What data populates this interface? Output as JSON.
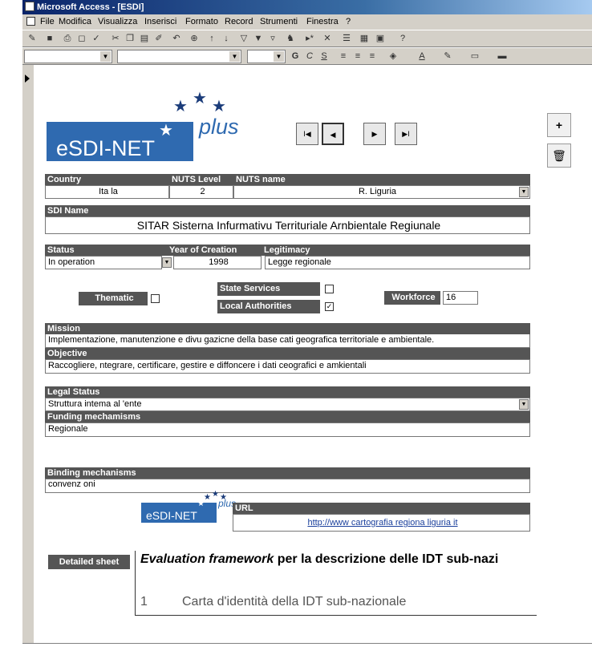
{
  "window": {
    "title": "Microsoft Access - [ESDI]"
  },
  "menu": [
    "File",
    "Modifica",
    "Visualizza",
    "Inserisci",
    "Formato",
    "Record",
    "Strumenti",
    "Finestra",
    "?"
  ],
  "toolbar2": {
    "bold": "G",
    "italic": "C",
    "underline": "S",
    "underline_A": "A"
  },
  "logo": {
    "main": "eSDI-NET",
    "suffix": "plus"
  },
  "nav": {
    "first": "I◀",
    "prev": "◀",
    "next": "▶",
    "last": "▶I"
  },
  "side_buttons": {
    "new_record": "+",
    "delete_record": "🗑"
  },
  "labels": {
    "country": "Country",
    "nuts_level": "NUTS Level",
    "nuts_name": "NUTS name",
    "sdi_name": "SDI Name",
    "status": "Status",
    "year_of_creation": "Year of Creation",
    "legitimacy": "Legitimacy",
    "thematic": "Thematic",
    "state_services": "State Services",
    "local_authorities": "Local Authorities",
    "workforce": "Workforce",
    "mission": "Mission",
    "objective": "Objective",
    "legal_status": "Legal Status",
    "funding_mechanisms": "Funding mechamisms",
    "binding_mechanisms": "Binding mechanisms",
    "url": "URL",
    "detailed_sheet": "Detailed sheet"
  },
  "values": {
    "country": "Ita la",
    "nuts_level": "2",
    "nuts_name": "R. Liguria",
    "sdi_name": "SITAR Sisterna Infurmativu Territuriale Arnbientale Regiunale",
    "status": "In operation",
    "year_of_creation": "1998",
    "legitimacy": "Legge regionale",
    "thematic_checked": false,
    "state_services_checked": false,
    "local_authorities_checked": true,
    "workforce": "16",
    "mission": "Implementazione, manutenzione e divu gazicne della base cati geografica territoriale e ambientale.",
    "objective": "Raccogliere, ntegrare, certificare, gestire e diffoncere i dati ceografici e amkientali",
    "legal_status": "Struttura intema al 'ente",
    "funding_mechanisms": "Regionale",
    "binding_mechanisms": "convenz oni",
    "url": "http://www cartografia regiona liguria it"
  },
  "detail": {
    "heading_italic": "Evaluation framework",
    "heading_rest": " per la descrizione delle IDT sub-nazi",
    "item_number": "1",
    "item_text": "Carta d'identità della IDT sub-nazionale"
  },
  "colors": {
    "header_bg": "#555555",
    "logo_blue": "#2f6ab0",
    "title_bar": "#0a246a"
  }
}
